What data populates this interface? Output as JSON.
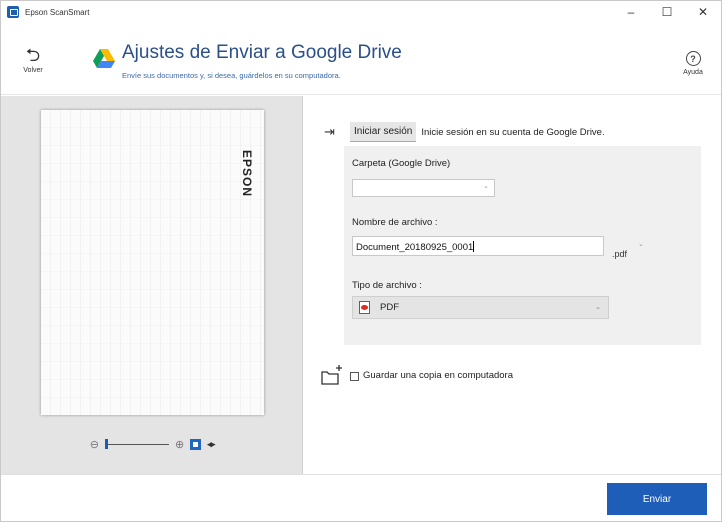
{
  "window": {
    "title": "Epson ScanSmart",
    "controls": {
      "minimize": "–",
      "maximize": "☐",
      "close": "✕"
    }
  },
  "header": {
    "back_label": "Volver",
    "title": "Ajustes de Enviar a Google Drive",
    "subtitle": "Envíe sus documentos y, si desea, guárdelos en su computadora.",
    "help_label": "Ayuda",
    "icons": {
      "back": "back-arrow-icon",
      "logo": "google-drive-icon",
      "help": "help-icon"
    }
  },
  "preview": {
    "brand_mark": "EPSON",
    "zoom": {
      "zoom_out_icon": "zoom-out-icon",
      "zoom_in_icon": "zoom-in-icon",
      "fit_icon": "fit-page-icon",
      "expand_icon": "expand-icon",
      "level": 0.0
    }
  },
  "settings": {
    "signin_button": "Iniciar sesión",
    "signin_text": "Inicie sesión en su cuenta de Google Drive.",
    "folder_label": "Carpeta (Google Drive)",
    "folder_value": "",
    "filename_label": "Nombre de archivo :",
    "filename_value": "Document_20180925_0001",
    "extension": ".pdf",
    "filetype_label": "Tipo de archivo :",
    "filetype_value": "PDF",
    "save_copy_label": "Guardar una copia en computadora",
    "save_copy_checked": false
  },
  "footer": {
    "send_button": "Enviar"
  },
  "colors": {
    "accent": "#1e5eb8",
    "title": "#2a4f8a",
    "panel_bg": "#e4e4e4",
    "form_bg": "#f0f0f0"
  }
}
